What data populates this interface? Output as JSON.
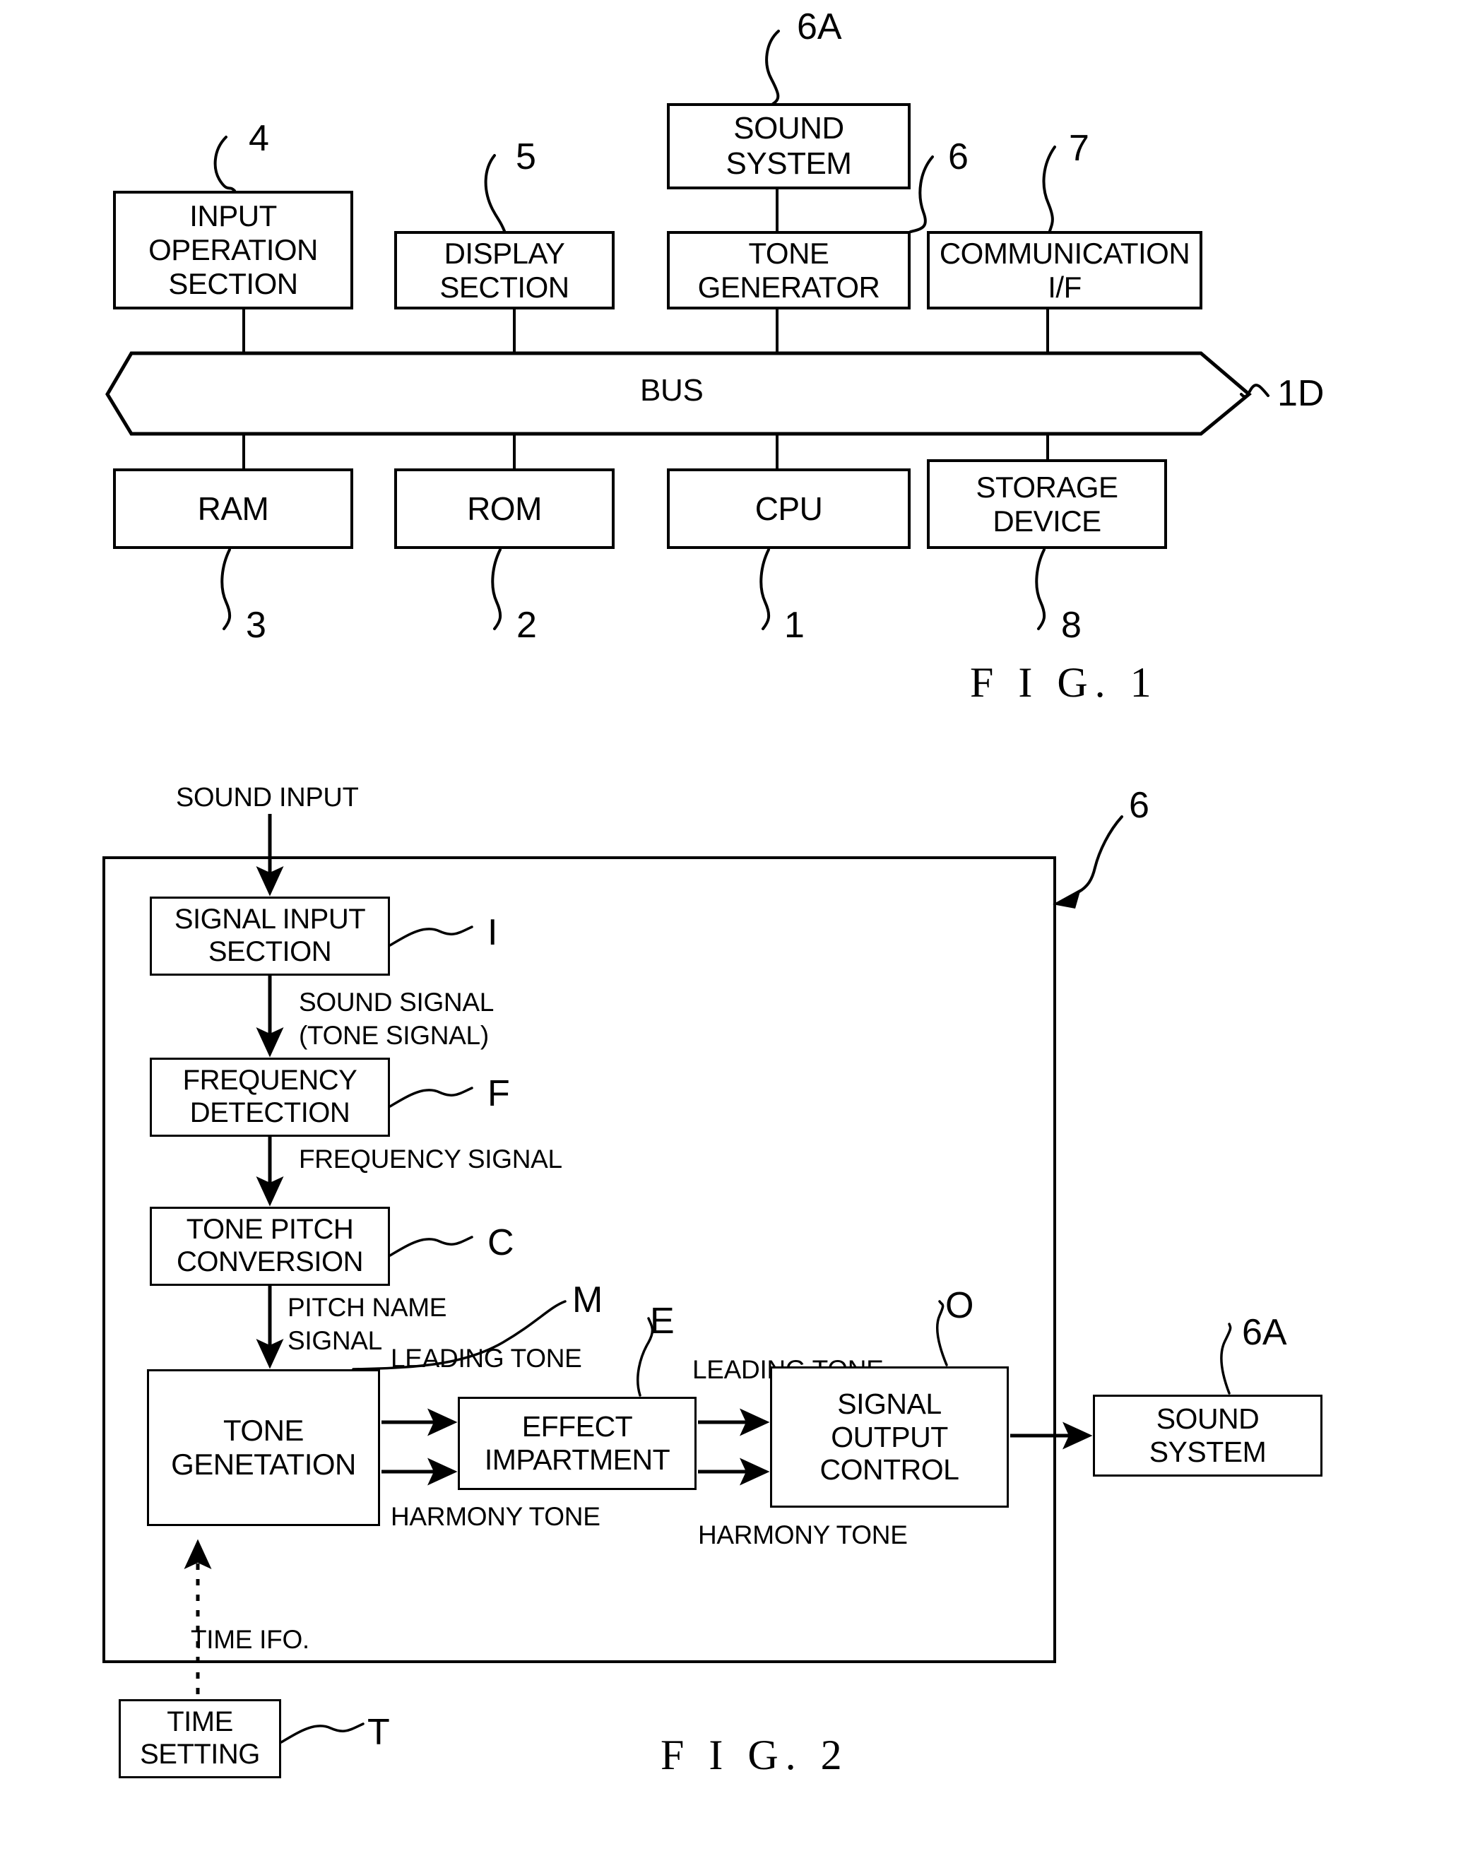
{
  "figure1": {
    "caption": "F I G.  1",
    "boxes": {
      "sound_system": {
        "line1": "SOUND",
        "line2": "SYSTEM"
      },
      "input_operation": {
        "line1": "INPUT",
        "line2": "OPERATION",
        "line3": "SECTION"
      },
      "display_section": {
        "line1": "DISPLAY",
        "line2": "SECTION"
      },
      "tone_generator": {
        "line1": "TONE",
        "line2": "GENERATOR"
      },
      "communication_if": {
        "line1": "COMMUNICATION",
        "line2": "I/F"
      },
      "bus": {
        "label": "BUS"
      },
      "ram": {
        "label": "RAM"
      },
      "rom": {
        "label": "ROM"
      },
      "cpu": {
        "label": "CPU"
      },
      "storage_device": {
        "line1": "STORAGE",
        "line2": "DEVICE"
      }
    },
    "refs": {
      "sound_system": "6A",
      "input_operation": "4",
      "display_section": "5",
      "tone_generator": "6",
      "communication_if": "7",
      "bus": "1D",
      "ram": "3",
      "rom": "2",
      "cpu": "1",
      "storage_device": "8"
    }
  },
  "figure2": {
    "caption": "F I G.  2",
    "frame_ref": "6",
    "input_label": "SOUND INPUT",
    "boxes": {
      "signal_input_section": {
        "line1": "SIGNAL INPUT",
        "line2": "SECTION"
      },
      "frequency_detection": {
        "line1": "FREQUENCY",
        "line2": "DETECTION"
      },
      "tone_pitch_conversion": {
        "line1": "TONE PITCH",
        "line2": "CONVERSION"
      },
      "tone_generation": {
        "line1": "TONE",
        "line2": "GENETATION"
      },
      "effect_impartment": {
        "line1": "EFFECT",
        "line2": "IMPARTMENT"
      },
      "signal_output_control": {
        "line1": "SIGNAL",
        "line2": "OUTPUT",
        "line3": "CONTROL"
      },
      "sound_system": {
        "line1": "SOUND",
        "line2": "SYSTEM"
      },
      "time_setting": {
        "line1": "TIME",
        "line2": "SETTING"
      }
    },
    "refs": {
      "signal_input_section": "I",
      "frequency_detection": "F",
      "tone_pitch_conversion": "C",
      "tone_generation": "M",
      "effect_impartment": "E",
      "signal_output_control": "O",
      "sound_system": "6A",
      "time_setting": "T"
    },
    "signal_labels": {
      "sound_signal_1": "SOUND SIGNAL",
      "sound_signal_2": "(TONE SIGNAL)",
      "frequency_signal": "FREQUENCY SIGNAL",
      "pitch_name_1": "PITCH NAME",
      "pitch_name_2": "SIGNAL",
      "leading_tone_left": "LEADING TONE",
      "harmony_tone_left": "HARMONY TONE",
      "leading_tone_right": "LEADING TONE",
      "harmony_tone_right": "HARMONY TONE",
      "time_info": "TIME IFO."
    }
  }
}
